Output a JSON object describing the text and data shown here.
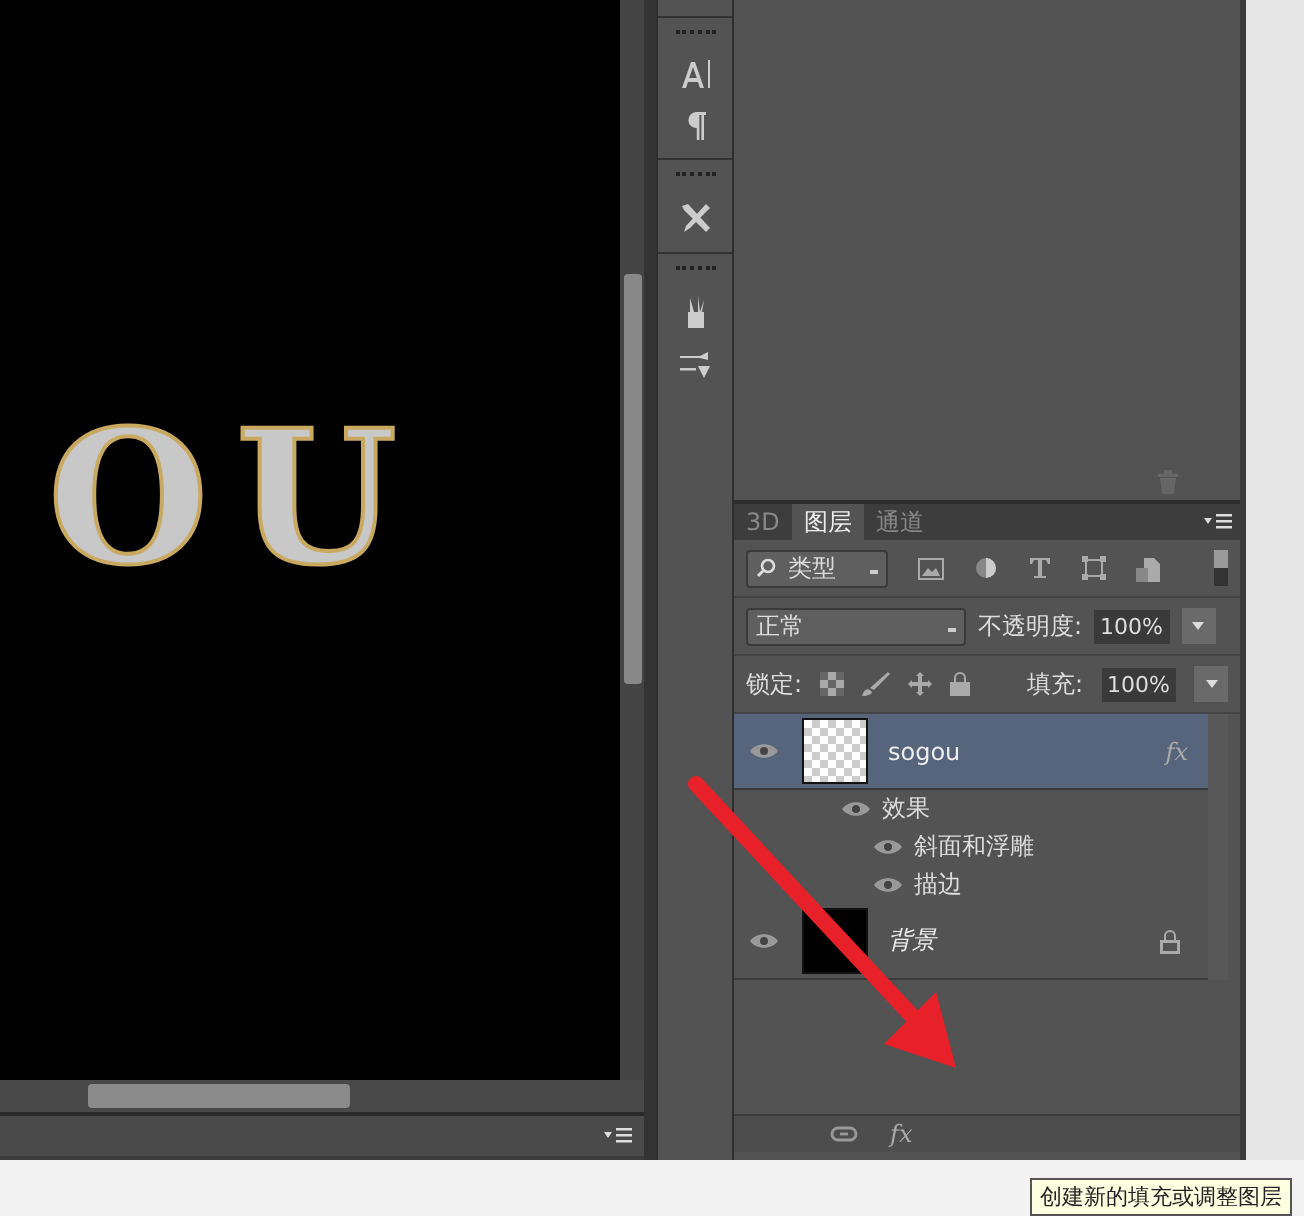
{
  "canvas": {
    "artwork_text": "OU"
  },
  "layers_panel": {
    "tabs": [
      {
        "label": "3D",
        "selected": false
      },
      {
        "label": "图层",
        "selected": true
      },
      {
        "label": "通道",
        "selected": false
      }
    ],
    "filter": {
      "value": "类型"
    },
    "blend_mode": {
      "value": "正常"
    },
    "opacity": {
      "label": "不透明度:",
      "value": "100%"
    },
    "lock": {
      "label": "锁定:"
    },
    "fill": {
      "label": "填充:",
      "value": "100%"
    },
    "layers": [
      {
        "name": "sogou",
        "selected": true,
        "locked": false,
        "kind": "transparent",
        "fx": "fx",
        "effects_label": "效果",
        "effects": [
          {
            "name": "斜面和浮雕"
          },
          {
            "name": "描边"
          }
        ]
      },
      {
        "name": "背景",
        "selected": false,
        "locked": true,
        "kind": "solid"
      }
    ],
    "footer": {
      "fx": "fx"
    }
  },
  "tooltip": "创建新的填充或调整图层"
}
